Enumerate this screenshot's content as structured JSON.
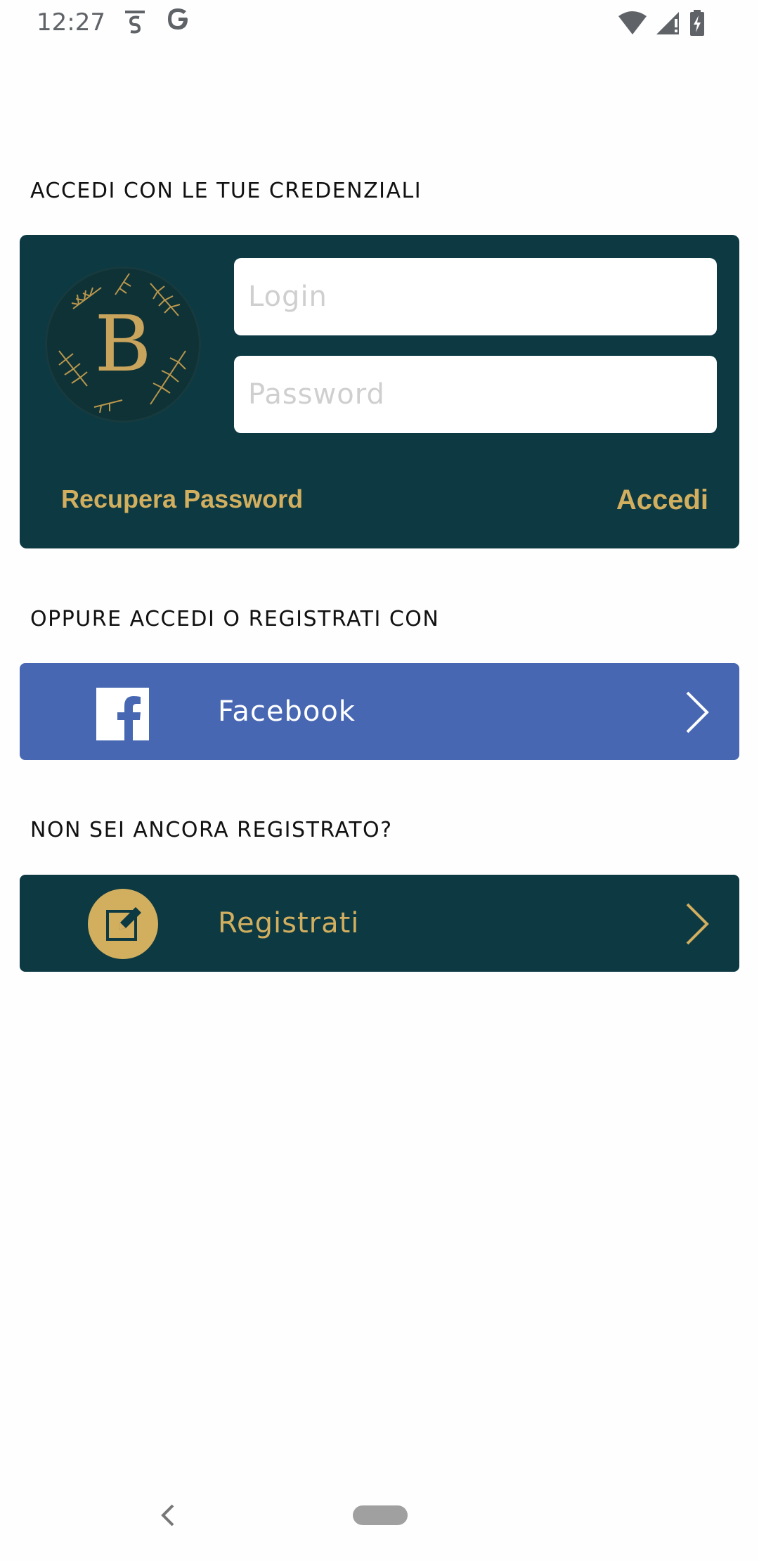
{
  "status_bar": {
    "time": "12:27",
    "icons": [
      "s-notification-icon",
      "google-icon",
      "wifi-icon",
      "signal-icon",
      "battery-charging-icon"
    ]
  },
  "login_section": {
    "heading": "ACCEDI CON LE TUE CREDENZIALI",
    "logo_letter": "B",
    "login_placeholder": "Login",
    "password_placeholder": "Password",
    "recover_password": "Recupera Password",
    "login_button": "Accedi"
  },
  "social_section": {
    "heading": "OPPURE ACCEDI O REGISTRATI CON",
    "facebook_label": "Facebook"
  },
  "register_section": {
    "heading": "NON SEI ANCORA REGISTRATO?",
    "register_label": "Registrati"
  },
  "colors": {
    "brand_dark": "#0c3942",
    "gold": "#d2ae5f",
    "facebook_blue": "#4767b2"
  }
}
